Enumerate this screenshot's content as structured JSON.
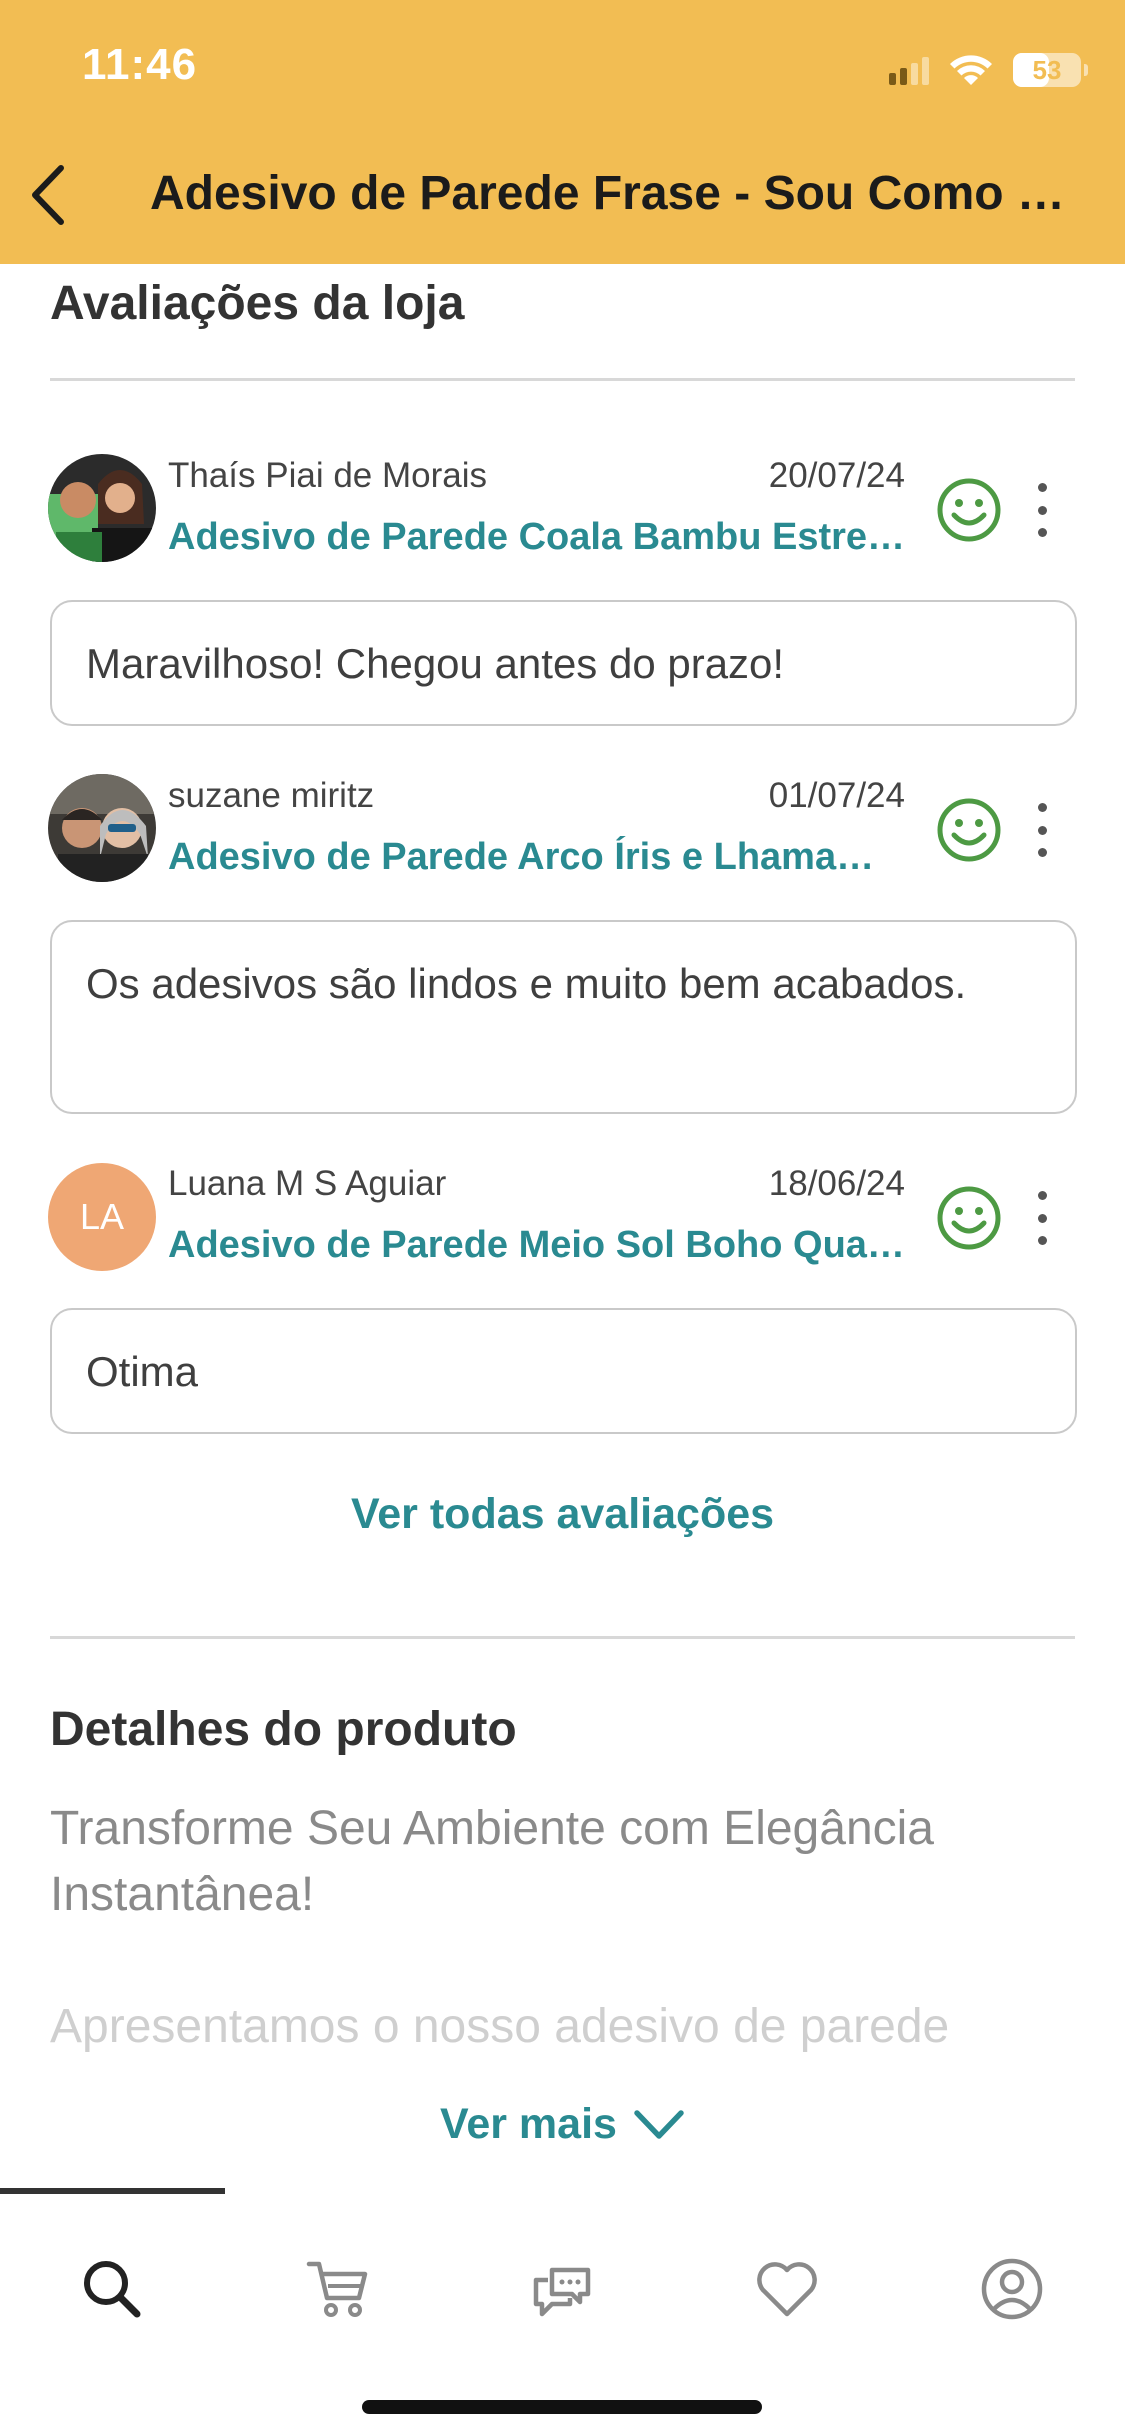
{
  "status_bar": {
    "time": "11:46",
    "battery": "53"
  },
  "header": {
    "title": "Adesivo de Parede Frase - Sou Como Sou Frase Lettering"
  },
  "reviews_section": {
    "title": "Avaliações da loja",
    "reviews": [
      {
        "name": "Thaís Piai de Morais",
        "date": "20/07/24",
        "product": "Adesivo de Parede Coala Bambu Estrelas",
        "comment": "Maravilhoso! Chegou antes do prazo!",
        "avatar_initials": ""
      },
      {
        "name": "suzane miritz",
        "date": "01/07/24",
        "product": "Adesivo de Parede Arco Íris e Lhama Infantil",
        "comment": "Os adesivos são lindos e muito bem acabados.",
        "avatar_initials": ""
      },
      {
        "name": "Luana M S Aguiar",
        "date": "18/06/24",
        "product": "Adesivo de Parede Meio Sol Boho Quarto Infantil",
        "comment": "Otima",
        "avatar_initials": "LA"
      }
    ],
    "see_all_label": "Ver todas avaliações"
  },
  "product_details": {
    "title": "Detalhes do produto",
    "paragraph1": "Transforme Seu Ambiente com Elegância Instantânea!",
    "paragraph2": "Apresentamos o nosso adesivo de parede",
    "see_more_label": "Ver mais"
  },
  "tabbar": {
    "tabs": [
      {
        "icon": "search-icon",
        "active": true
      },
      {
        "icon": "cart-icon",
        "active": false
      },
      {
        "icon": "chat-icon",
        "active": false
      },
      {
        "icon": "heart-icon",
        "active": false
      },
      {
        "icon": "account-icon",
        "active": false
      }
    ]
  },
  "colors": {
    "header_bg": "#F2BD53",
    "link": "#2a8a91",
    "positive": "#4d9a43",
    "avatar_initials_bg": "#EFA774"
  }
}
